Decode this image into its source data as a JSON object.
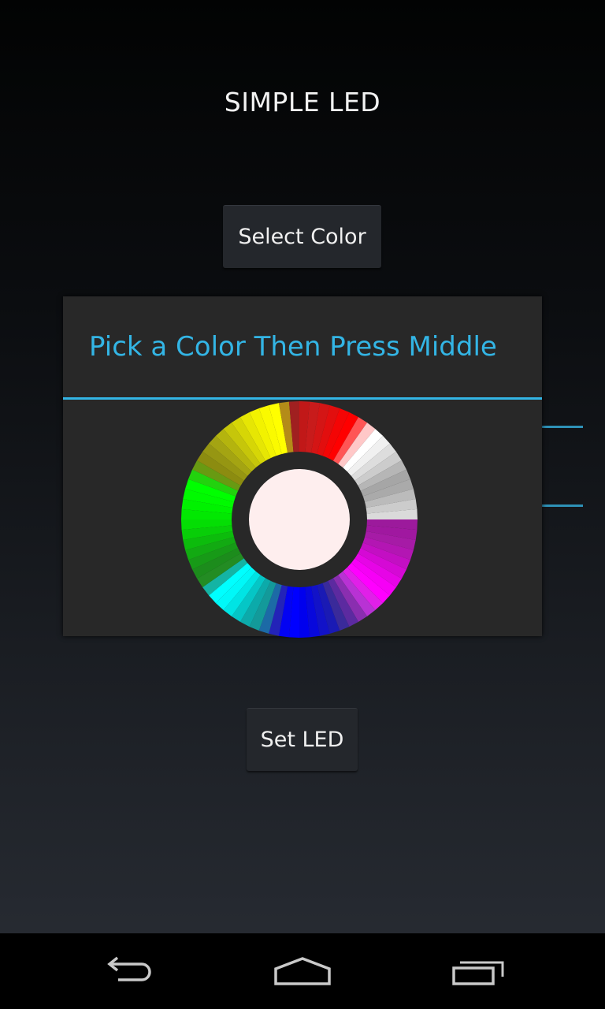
{
  "app": {
    "title": "SIMPLE LED"
  },
  "main": {
    "select_color_label": "Select Color",
    "set_led_label": "Set LED"
  },
  "dialog": {
    "title": "Pick a Color Then Press Middle",
    "selected_color": "#feeeee",
    "accent_color": "#33b5e5"
  },
  "navbar": {
    "buttons": [
      {
        "icon": "back-icon"
      },
      {
        "icon": "home-icon"
      },
      {
        "icon": "recent-apps-icon"
      }
    ]
  }
}
